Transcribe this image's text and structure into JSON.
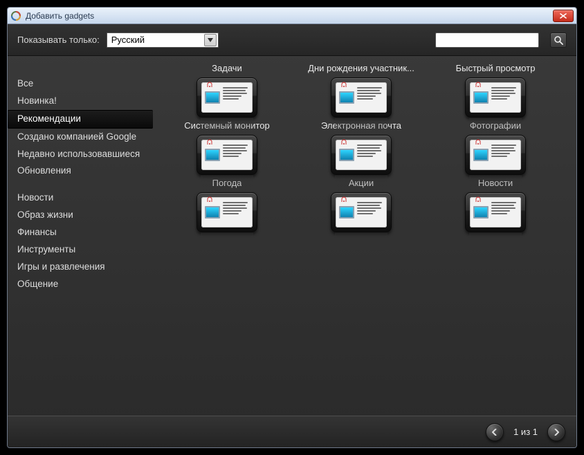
{
  "window": {
    "title": "Добавить gadgets"
  },
  "topbar": {
    "filter_label": "Показывать только:",
    "language": "Русский",
    "search_placeholder": ""
  },
  "sidebar": {
    "items": [
      {
        "id": "all",
        "label": "Все",
        "selected": false
      },
      {
        "id": "new",
        "label": "Новинка!",
        "selected": false
      },
      {
        "id": "recom",
        "label": "Рекомендации",
        "selected": true
      },
      {
        "id": "google",
        "label": "Создано компанией Google",
        "selected": false
      },
      {
        "id": "recent",
        "label": "Недавно использовавшиеся",
        "selected": false
      },
      {
        "id": "updates",
        "label": "Обновления",
        "selected": false
      },
      {
        "id": "gap",
        "label": "",
        "selected": false,
        "gap": true
      },
      {
        "id": "news",
        "label": "Новости",
        "selected": false
      },
      {
        "id": "lifestyle",
        "label": "Образ жизни",
        "selected": false
      },
      {
        "id": "finance",
        "label": "Финансы",
        "selected": false
      },
      {
        "id": "tools",
        "label": "Инструменты",
        "selected": false
      },
      {
        "id": "games",
        "label": "Игры и развлечения",
        "selected": false
      },
      {
        "id": "social",
        "label": "Общение",
        "selected": false
      }
    ]
  },
  "gadgets": [
    {
      "id": "tasks",
      "label": "Задачи"
    },
    {
      "id": "birthdays",
      "label": "Дни рождения участник..."
    },
    {
      "id": "quickview",
      "label": "Быстрый просмотр"
    },
    {
      "id": "sysmon",
      "label": "Системный монитор"
    },
    {
      "id": "email",
      "label": "Электронная почта"
    },
    {
      "id": "photos",
      "label": "Фотографии"
    },
    {
      "id": "weather",
      "label": "Погода"
    },
    {
      "id": "stocks",
      "label": "Акции"
    },
    {
      "id": "news2",
      "label": "Новости"
    }
  ],
  "footer": {
    "pager": "1 из 1"
  }
}
